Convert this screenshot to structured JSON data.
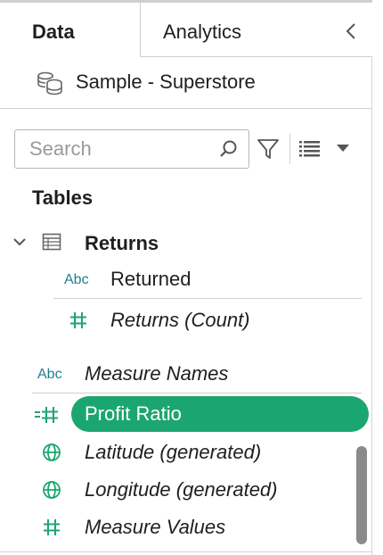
{
  "tabs": {
    "data_label": "Data",
    "analytics_label": "Analytics"
  },
  "datasource": {
    "name": "Sample - Superstore"
  },
  "search": {
    "placeholder": "Search",
    "value": ""
  },
  "tables_heading": "Tables",
  "table": {
    "name": "Returns",
    "fields": [
      {
        "type_badge": "Abc",
        "name": "Returned"
      },
      {
        "type_badge": "#",
        "name": "Returns (Count)"
      }
    ]
  },
  "fields": [
    {
      "type_badge": "Abc",
      "name": "Measure Names"
    },
    {
      "type_badge": "=#",
      "name": "Profit Ratio"
    },
    {
      "type_badge": "globe",
      "name": "Latitude (generated)"
    },
    {
      "type_badge": "globe",
      "name": "Longitude (generated)"
    },
    {
      "type_badge": "#",
      "name": "Measure Values"
    }
  ],
  "colors": {
    "measure_green": "#1ca66f",
    "dimension_teal": "#1e7f8c",
    "selected_pill": "#1ca66f"
  }
}
